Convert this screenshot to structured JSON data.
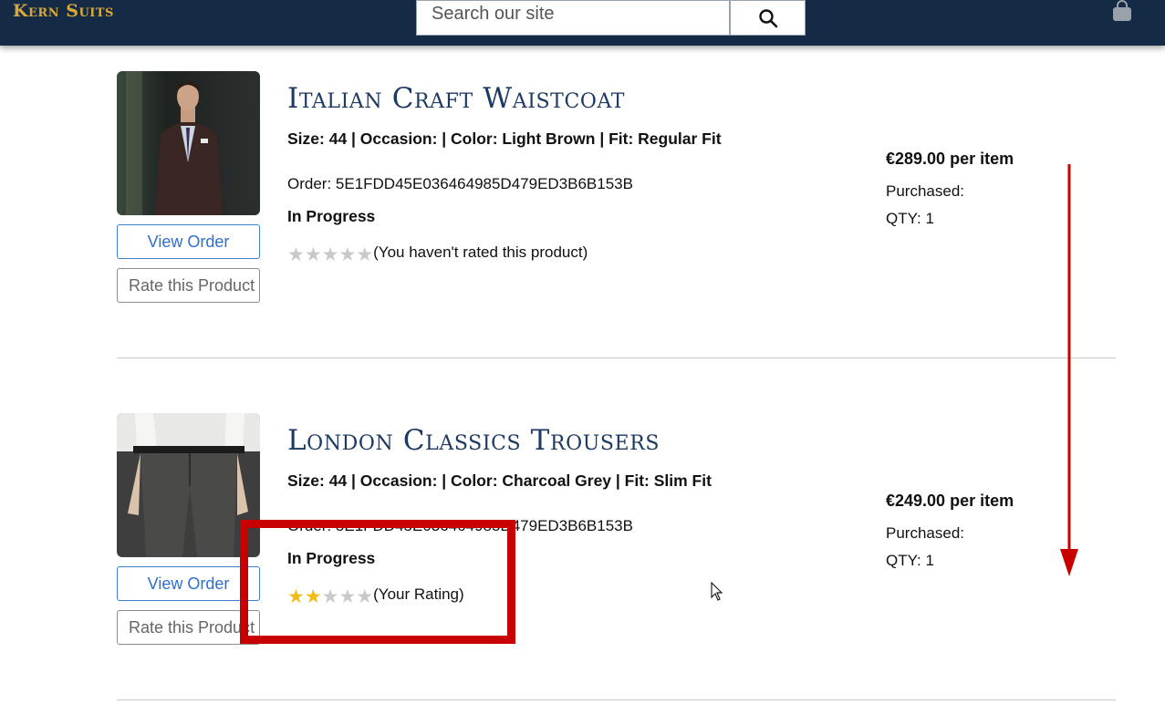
{
  "header": {
    "logo": "Kern Suits",
    "search_placeholder": "Search our site",
    "colors": {
      "navbar": "#152a45",
      "logo": "#d7a93a"
    }
  },
  "orders": [
    {
      "title": "Italian Craft Waistcoat",
      "attributes": "Size: 44 | Occasion: | Color: Light Brown | Fit: Regular Fit",
      "order_number": "Order: 5E1FDD45E036464985D479ED3B6B153B",
      "status": "In Progress",
      "rating_stars": 0,
      "rating_text": "(You haven't rated this product)",
      "price": "€289.00",
      "price_suffix": "per item",
      "purchased_label": "Purchased:",
      "qty": "QTY: 1",
      "view_button": "View Order",
      "rate_button": "Rate this Product",
      "image_icon": "man-in-brown-suit-photo"
    },
    {
      "title": "London Classics Trousers",
      "attributes": "Size: 44 | Occasion: | Color: Charcoal Grey | Fit: Slim Fit",
      "order_number": "Order: 5E1FDD45E036464985D479ED3B6B153B",
      "status": "In Progress",
      "rating_stars": 2,
      "rating_text": "(Your Rating)",
      "price": "€249.00",
      "price_suffix": "per item",
      "purchased_label": "Purchased:",
      "qty": "QTY: 1",
      "view_button": "View Order",
      "rate_button": "Rate this Product",
      "image_icon": "charcoal-trousers-photo"
    }
  ],
  "annotations": {
    "highlight_color": "#c80000",
    "scroll_arrow_color": "#c80000"
  }
}
